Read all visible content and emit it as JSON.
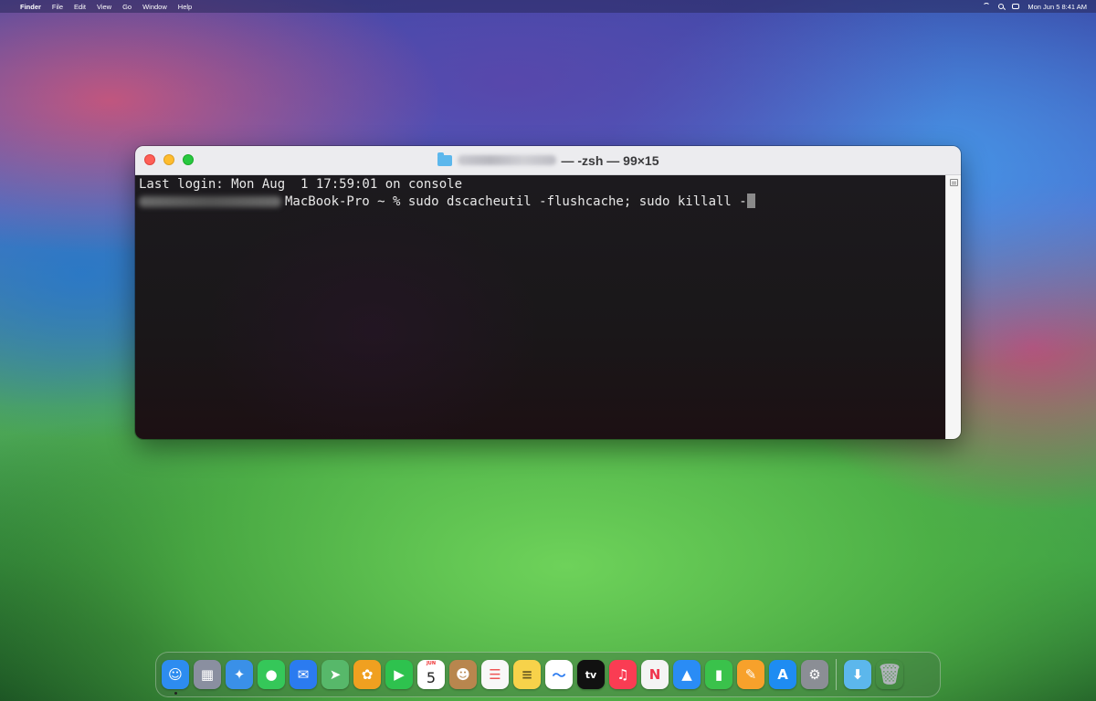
{
  "menubar": {
    "apple": "",
    "app_name": "Finder",
    "menus": [
      "File",
      "Edit",
      "View",
      "Go",
      "Window",
      "Help"
    ],
    "datetime": "Mon Jun 5  8:41 AM"
  },
  "window": {
    "title_suffix": "— -zsh — 99×15",
    "lines": {
      "last_login": "Last login: Mon Aug  1 17:59:01 on console",
      "prompt": "MacBook-Pro ~ % ",
      "command": "sudo dscacheutil -flushcache; sudo killall -"
    }
  },
  "dock": {
    "items": [
      {
        "name": "finder",
        "glyph": "☺",
        "color": "#2d8cf0",
        "running": true
      },
      {
        "name": "launchpad",
        "glyph": "▦",
        "color": "#8a8fa0"
      },
      {
        "name": "safari",
        "glyph": "✦",
        "color": "#3a90e8"
      },
      {
        "name": "messages",
        "glyph": "●",
        "color": "#35c759"
      },
      {
        "name": "mail",
        "glyph": "✉",
        "color": "#2b7bf0"
      },
      {
        "name": "maps",
        "glyph": "➤",
        "color": "#57b86a"
      },
      {
        "name": "photos",
        "glyph": "✿",
        "color": "#f0a020"
      },
      {
        "name": "facetime",
        "glyph": "▶",
        "color": "#2ec24e"
      },
      {
        "name": "calendar",
        "glyph": "5",
        "color": "#ffffff",
        "text_color": "#222222",
        "month": "JUN"
      },
      {
        "name": "contacts",
        "glyph": "☻",
        "color": "#b8864e"
      },
      {
        "name": "reminders",
        "glyph": "☰",
        "color": "#f8f8f8",
        "text_color": "#e55"
      },
      {
        "name": "notes",
        "glyph": "≡",
        "color": "#f7d24a",
        "text_color": "#6a5a20"
      },
      {
        "name": "freeform",
        "glyph": "〜",
        "color": "#ffffff",
        "text_color": "#2b7bf0"
      },
      {
        "name": "apple-tv",
        "glyph": "tv",
        "color": "#111111"
      },
      {
        "name": "music",
        "glyph": "♫",
        "color": "#fa3c53"
      },
      {
        "name": "news",
        "glyph": "N",
        "color": "#f4f4f4",
        "text_color": "#f0344e"
      },
      {
        "name": "keynote",
        "glyph": "▲",
        "color": "#2a8cf5"
      },
      {
        "name": "numbers",
        "glyph": "▮",
        "color": "#3ac24b"
      },
      {
        "name": "pages",
        "glyph": "✎",
        "color": "#f7a12b"
      },
      {
        "name": "app-store",
        "glyph": "A",
        "color": "#1e8cf2"
      },
      {
        "name": "system-settings",
        "glyph": "⚙",
        "color": "#8b8e95"
      },
      {
        "name": "downloads-folder",
        "glyph": "⬇",
        "color": "#5cb7ec",
        "after_separator": true
      },
      {
        "name": "trash",
        "glyph": "🗑",
        "color": "transparent",
        "text_color": "#b0b4ba"
      }
    ]
  }
}
